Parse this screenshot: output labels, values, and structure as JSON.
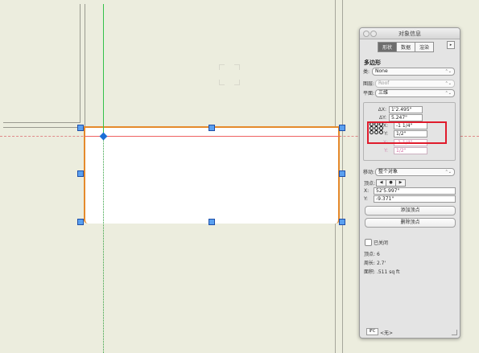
{
  "palette": {
    "title": "对象信息",
    "tabs": [
      "形状",
      "数据",
      "渲染"
    ],
    "tab_menu": "▸",
    "section_title": "多边形",
    "class_label": "类:",
    "class_value": "None",
    "layer_label": "图层:",
    "layer_value": "Roof",
    "plane_label": "平面:",
    "plane_value": "三维",
    "delta_x_label": "ΔX:",
    "delta_x_value": "1'2.495\"",
    "delta_y_label": "ΔY:",
    "delta_y_value": "5.247\"",
    "x_label": "X:",
    "x_value": "-1 1/4\"",
    "y_label": "Y:",
    "y_value": "1/2\"",
    "x2_label": "X:",
    "x2_value": "-1 1/4\"",
    "y2_label": "Y:",
    "y2_value": "1/2\"",
    "move_label": "移动:",
    "move_value": "整个对象",
    "vertex_label": "顶点:",
    "vertex_prev": "◀",
    "vertex_dot": "●",
    "vertex_next": "▶",
    "vx_label": "X:",
    "vx_value": "52'5.997\"",
    "vy_label": "Y:",
    "vy_value": "-9.371\"",
    "add_vertex": "添加顶点",
    "delete_vertex": "删除顶点",
    "closed_label": "已关闭",
    "vertices_label": "顶点:",
    "vertices_value": "6",
    "perimeter_label": "周长:",
    "perimeter_value": "2.7'",
    "area_label": "面积:",
    "area_value": ".511 sq ft",
    "footer_box": "IFC",
    "footer_text": "<无>",
    "select_arrows": "⌃⌄"
  },
  "colors": {
    "shape_stroke": "#e58a2c",
    "guide_green": "#34c24a",
    "guide_red": "#ef6262",
    "highlight_box": "#e01b2c",
    "handle_blue": "#5aa0f0"
  }
}
